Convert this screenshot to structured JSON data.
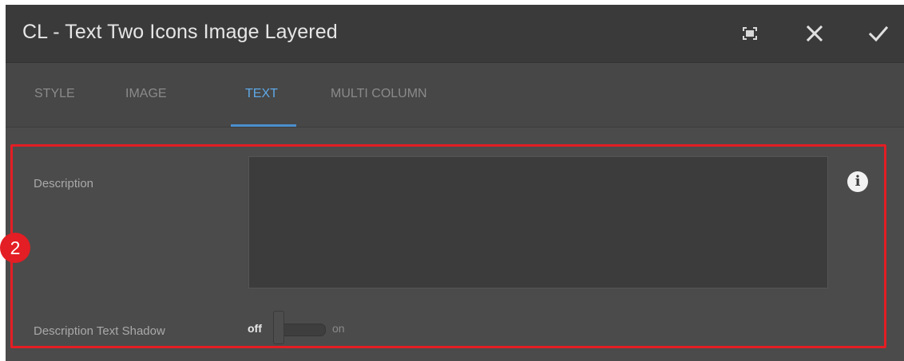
{
  "dialog": {
    "title": "CL - Text Two Icons Image Layered",
    "buttons": [
      {
        "name": "fullscreen",
        "icon": "fullscreen-icon"
      },
      {
        "name": "close",
        "icon": "close-icon"
      },
      {
        "name": "done",
        "icon": "checkmark-icon"
      }
    ]
  },
  "tabs": {
    "items": [
      {
        "label": "STYLE",
        "active": false
      },
      {
        "label": "IMAGE",
        "active": false
      },
      {
        "label": "TEXT",
        "active": true
      },
      {
        "label": "MULTI COLUMN",
        "active": false
      }
    ],
    "active_color": "#5ea8e6"
  },
  "form": {
    "description": {
      "label": "Description",
      "value": ""
    },
    "info_icon": "info-icon",
    "text_shadow": {
      "label": "Description Text Shadow",
      "off_label": "off",
      "on_label": "on",
      "state": "off"
    }
  },
  "annotation": {
    "step_number": "2",
    "color": "#e31e24"
  }
}
